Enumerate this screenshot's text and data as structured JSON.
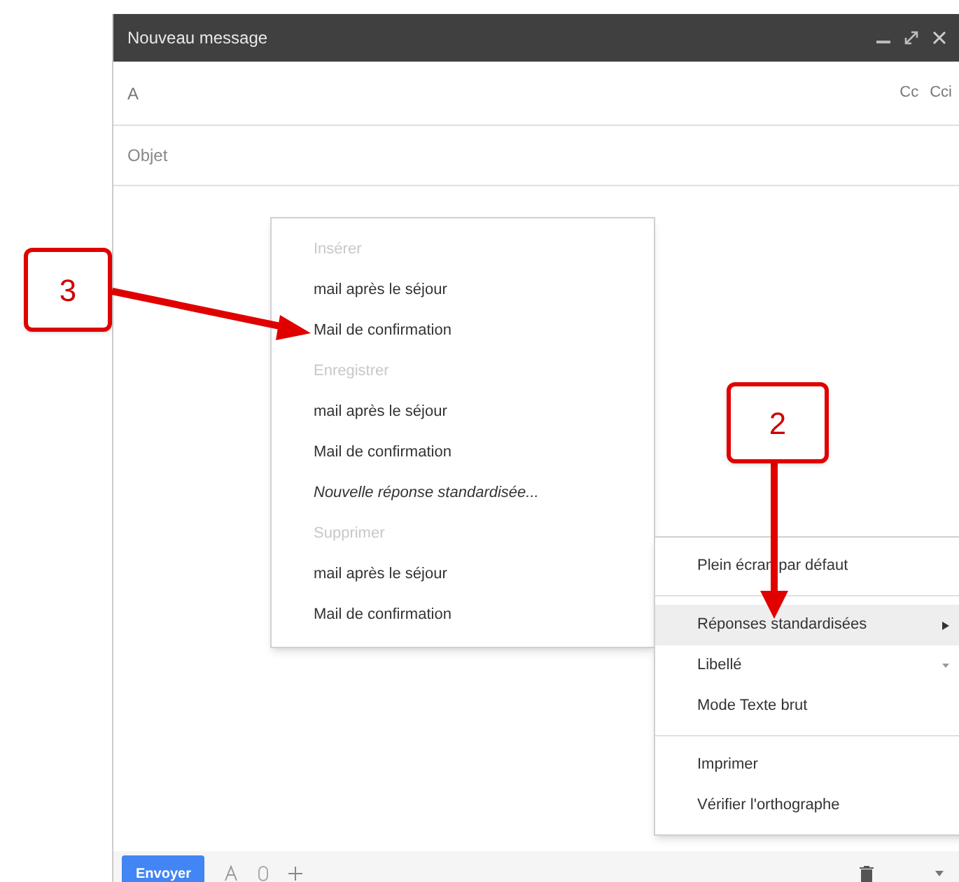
{
  "window": {
    "title": "Nouveau message"
  },
  "recipients": {
    "label": "A",
    "cc": "Cc",
    "bcc": "Cci"
  },
  "subject": {
    "placeholder": "Objet"
  },
  "canned_menu": {
    "sections": [
      {
        "header": "Insérer",
        "items": [
          {
            "label": "mail après le séjour",
            "kind": "item"
          },
          {
            "label": "Mail de confirmation",
            "kind": "item"
          }
        ]
      },
      {
        "header": "Enregistrer",
        "items": [
          {
            "label": "mail après le séjour",
            "kind": "item"
          },
          {
            "label": "Mail de confirmation",
            "kind": "item"
          },
          {
            "label": "Nouvelle réponse standardisée...",
            "kind": "new"
          }
        ]
      },
      {
        "header": "Supprimer",
        "items": [
          {
            "label": "mail après le séjour",
            "kind": "item"
          },
          {
            "label": "Mail de confirmation",
            "kind": "item"
          }
        ]
      }
    ]
  },
  "options_menu": {
    "groups": [
      [
        {
          "label": "Plein écran par défaut",
          "selected": false,
          "kind": "plain"
        }
      ],
      [
        {
          "label": "Réponses standardisées",
          "selected": true,
          "kind": "submenu"
        },
        {
          "label": "Libellé",
          "selected": false,
          "kind": "dropdown"
        },
        {
          "label": "Mode Texte brut",
          "selected": false,
          "kind": "plain"
        }
      ],
      [
        {
          "label": "Imprimer",
          "selected": false,
          "kind": "plain"
        },
        {
          "label": "Vérifier l'orthographe",
          "selected": false,
          "kind": "plain"
        }
      ]
    ]
  },
  "callouts": [
    {
      "number": "3"
    },
    {
      "number": "2"
    }
  ],
  "toolbar": {
    "send": "Envoyer"
  }
}
